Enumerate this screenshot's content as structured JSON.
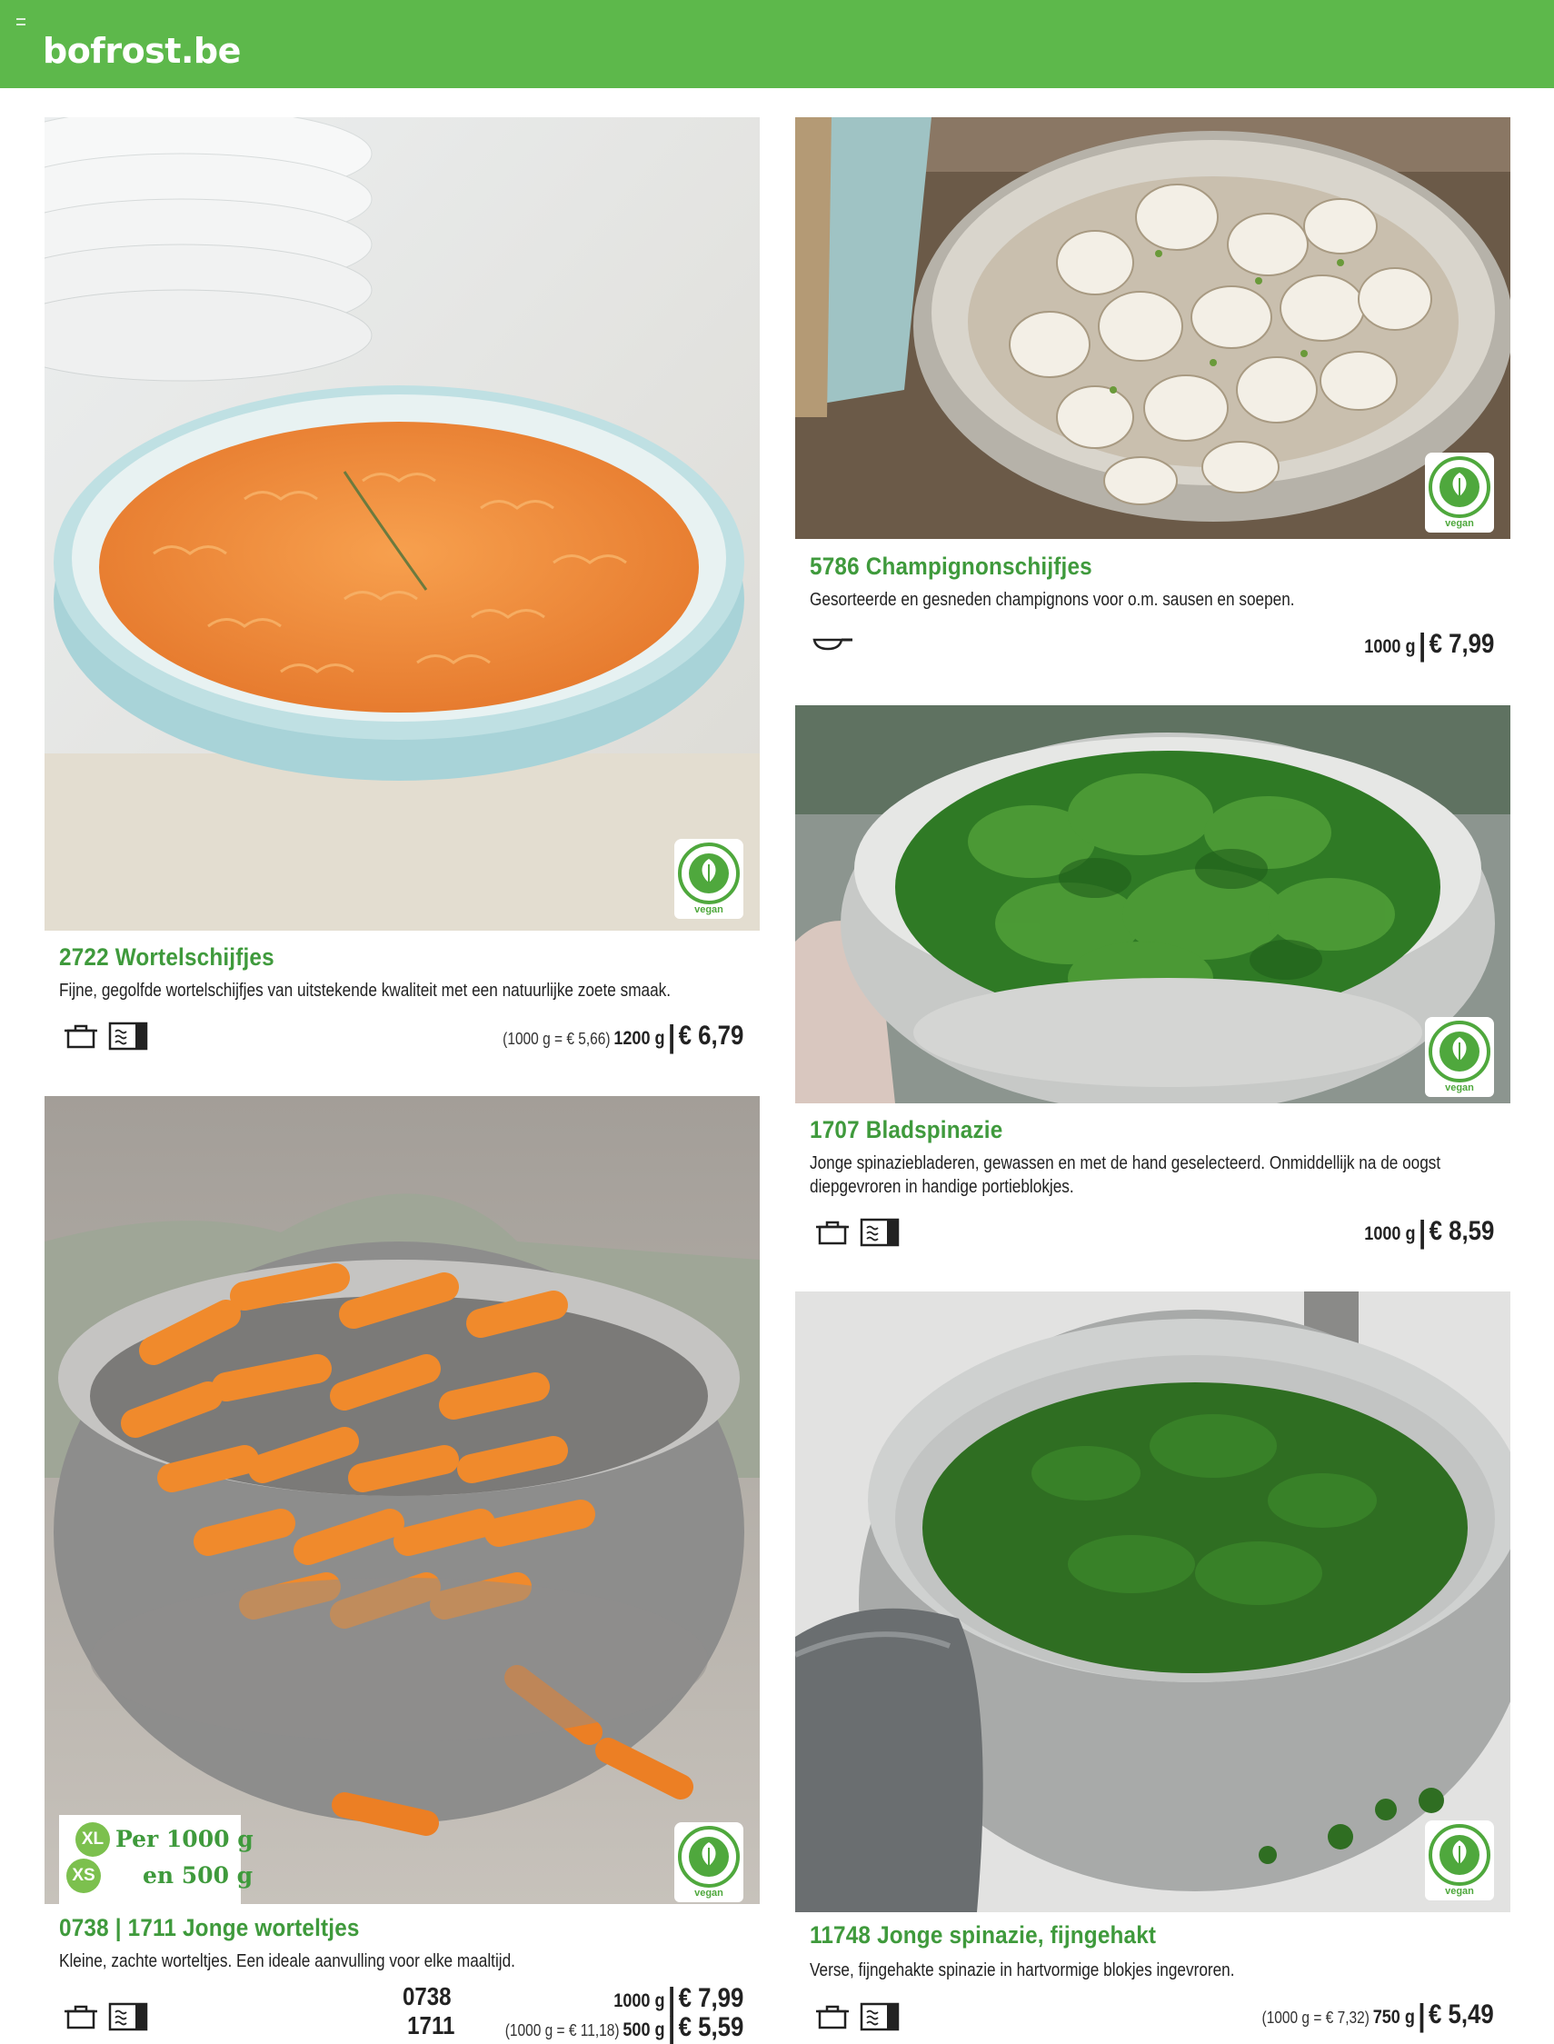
{
  "header": {
    "brand": "bofrost.be"
  },
  "vegan_label": "vegan",
  "products": {
    "wortelschijfjes": {
      "title": "2722  Wortelschijfjes",
      "desc": "Fijne, gegolfde wortelschijfjes van uitstekende kwaliteit met een natuurlijke zoete smaak.",
      "unit_price": "(1000 g = € 5,66)",
      "weight": "1200 g",
      "price": "€ 6,79",
      "icons": [
        "pot-icon",
        "oven-icon"
      ]
    },
    "champignons": {
      "title": "5786  Champignonschijfjes",
      "desc": "Gesorteerde en gesneden champignons voor o.m. sausen en soepen.",
      "weight": "1000 g",
      "price": "€ 7,99",
      "icons": [
        "pan-icon"
      ]
    },
    "bladspinazie": {
      "title": "1707  Bladspinazie",
      "desc": "Jonge spinaziebladeren, gewassen en met de hand geselecteerd. Onmiddellijk na de oogst diepgevroren in handige portieblokjes.",
      "weight": "1000 g",
      "price": "€ 8,59",
      "icons": [
        "pot-icon",
        "oven-icon"
      ]
    },
    "worteltjes": {
      "title": "0738 | 1711  Jonge worteltjes",
      "desc": "Kleine, zachte worteltjes. Een ideale aanvulling voor elke maaltijd.",
      "xl_badge": "XL",
      "xs_badge": "XS",
      "xl_text": "Per 1000 g",
      "xs_text": "en 500 g",
      "code1": "0738",
      "code2": "1711",
      "weight1": "1000 g",
      "price1": "€ 7,99",
      "unit_price2": "(1000 g = € 11,18)",
      "weight2": "500 g",
      "price2": "€ 5,59",
      "icons": [
        "pot-icon",
        "oven-icon"
      ]
    },
    "fijngehakt": {
      "title": "11748  Jonge spinazie, fijngehakt",
      "desc": "Verse, fijngehakte spinazie in hartvormige blokjes ingevroren.",
      "unit_price": "(1000 g = € 7,32)",
      "weight": "750 g",
      "price": "€ 5,49",
      "icons": [
        "pot-icon",
        "oven-icon"
      ]
    }
  },
  "colors": {
    "brand_green": "#5db84b",
    "title_green": "#3f9a3c"
  }
}
